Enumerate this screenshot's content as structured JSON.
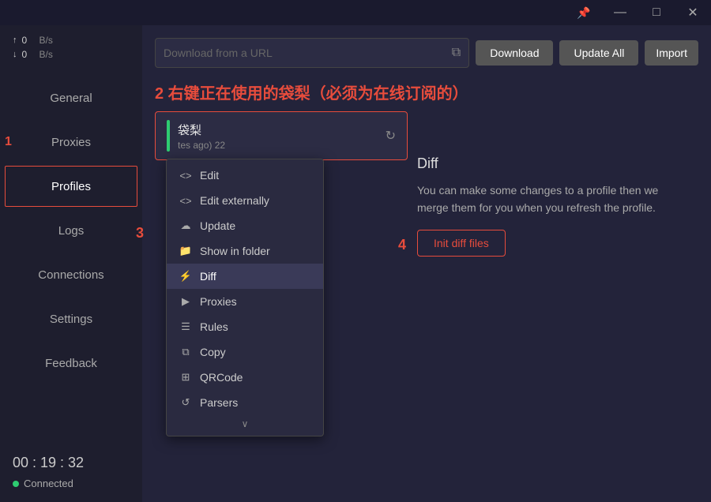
{
  "titlebar": {
    "pin_icon": "📌",
    "minimize_icon": "—",
    "maximize_icon": "□",
    "close_icon": "✕"
  },
  "sidebar": {
    "stats": {
      "upload_arrow": "↑",
      "download_arrow": "↓",
      "upload_val": "0",
      "download_val": "0",
      "unit": "B/s"
    },
    "nav_items": [
      {
        "label": "General",
        "active": false
      },
      {
        "label": "Proxies",
        "active": false
      },
      {
        "label": "Profiles",
        "active": true
      },
      {
        "label": "Logs",
        "active": false
      },
      {
        "label": "Connections",
        "active": false
      },
      {
        "label": "Settings",
        "active": false
      },
      {
        "label": "Feedback",
        "active": false
      }
    ],
    "time": "00 : 19 : 32",
    "status": "Connected"
  },
  "topbar": {
    "url_placeholder": "Download from a URL",
    "download_label": "Download",
    "update_all_label": "Update All",
    "import_label": "Import"
  },
  "annotation": {
    "text2": "2 右键正在使用的袋梨（必须为在线订阅的）",
    "step1": "1",
    "step3": "3",
    "step4": "4"
  },
  "profile": {
    "name": "袋梨",
    "meta": "tes ago)",
    "meta2": "22"
  },
  "context_menu": {
    "items": [
      {
        "icon": "<>",
        "label": "Edit"
      },
      {
        "icon": "<>",
        "label": "Edit externally"
      },
      {
        "icon": "☁",
        "label": "Update"
      },
      {
        "icon": "📁",
        "label": "Show in folder"
      },
      {
        "icon": "⚡",
        "label": "Diff",
        "active": true
      },
      {
        "icon": "▶",
        "label": "Proxies"
      },
      {
        "icon": "☰",
        "label": "Rules"
      },
      {
        "icon": "⧉",
        "label": "Copy"
      },
      {
        "icon": "⊞",
        "label": "QRCode"
      },
      {
        "icon": "⟲",
        "label": "Parsers"
      }
    ],
    "chevron_down": "∨"
  },
  "diff_panel": {
    "title": "Diff",
    "description": "You can make some changes to a profile then we merge them for you when you refresh the profile.",
    "button_label": "Init diff files"
  }
}
